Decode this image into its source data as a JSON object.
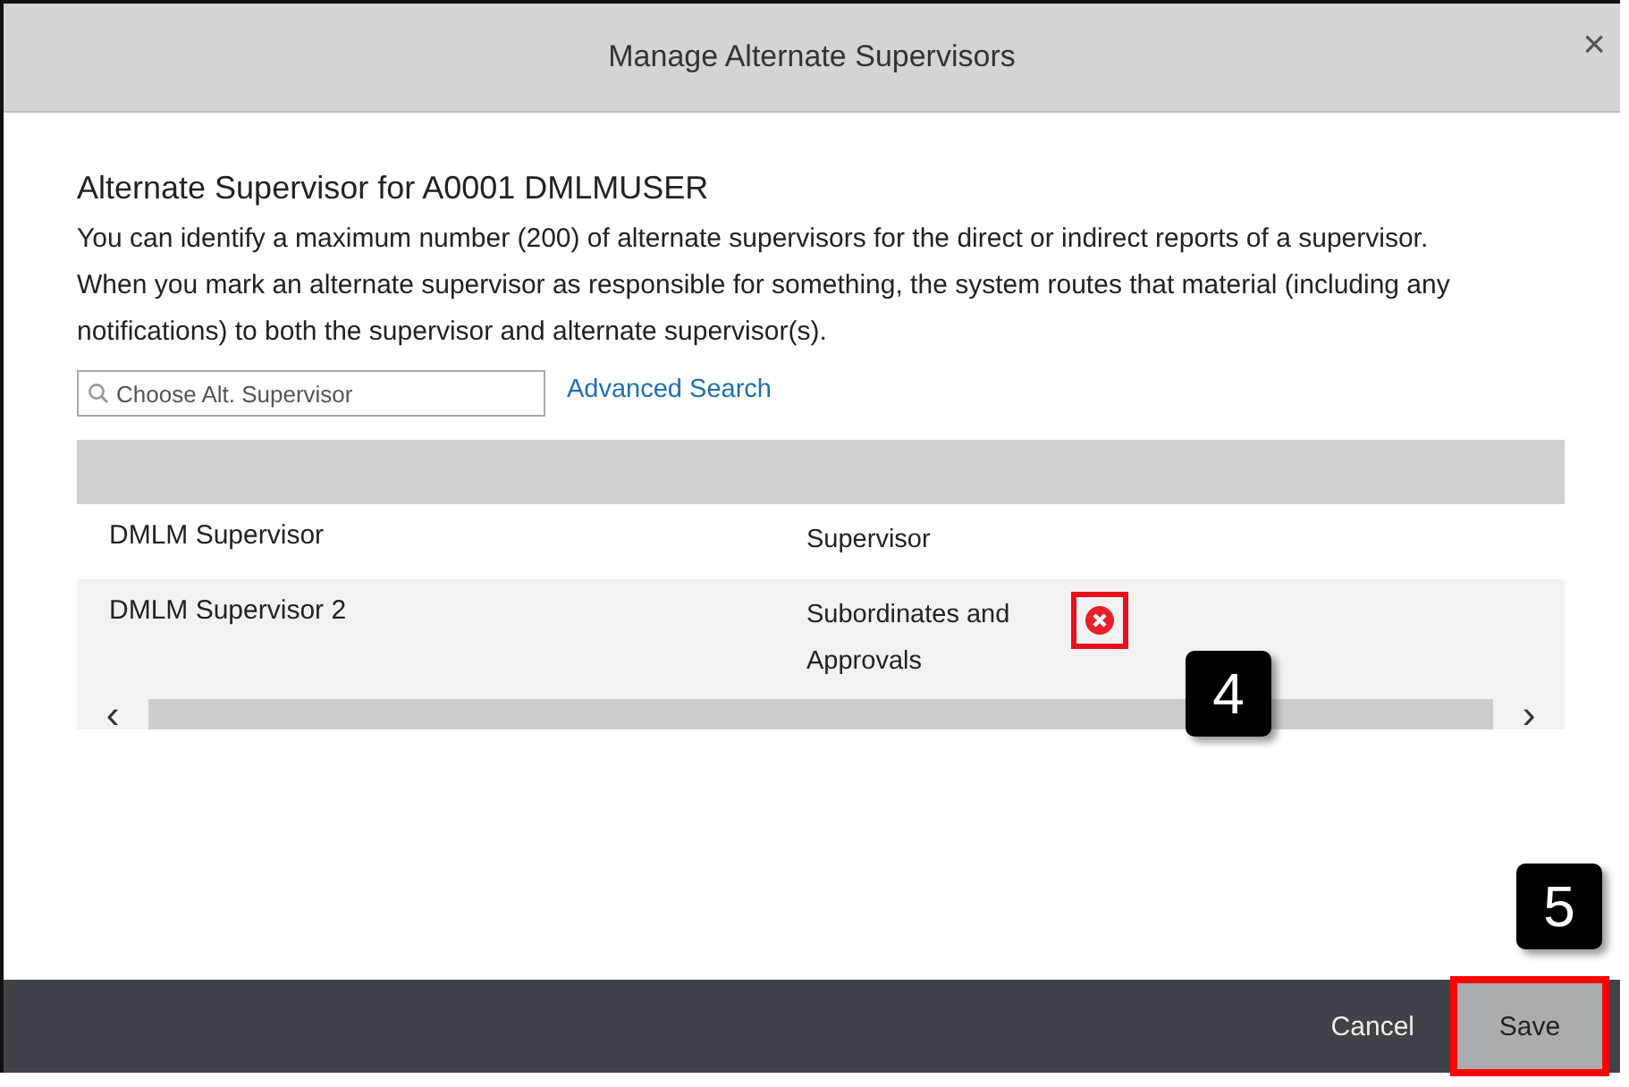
{
  "dialog": {
    "title": "Manage Alternate Supervisors",
    "close": "×"
  },
  "heading": "Alternate Supervisor for A0001 DMLMUSER",
  "description": "You can identify a maximum number (200) of alternate supervisors for the direct or indirect reports of a supervisor. When you mark an alternate supervisor as responsible for something, the system routes that material (including any notifications) to both the supervisor and alternate supervisor(s).",
  "search": {
    "placeholder": "Choose Alt. Supervisor"
  },
  "advanced_search": "Advanced Search",
  "table": {
    "rows": [
      {
        "name": "DMLM Supervisor",
        "role": "Supervisor",
        "removable": false
      },
      {
        "name": "DMLM Supervisor 2",
        "role": "Subordinates and Approvals",
        "removable": true,
        "highlighted": true
      }
    ],
    "scroll_left": "‹",
    "scroll_right": "›"
  },
  "footer": {
    "buttons": [
      {
        "label": "Cancel",
        "kind": "text",
        "highlighted": false
      },
      {
        "label": "Save",
        "kind": "filled",
        "highlighted": true
      }
    ]
  },
  "callouts": [
    {
      "label": "4"
    },
    {
      "label": "5"
    }
  ]
}
